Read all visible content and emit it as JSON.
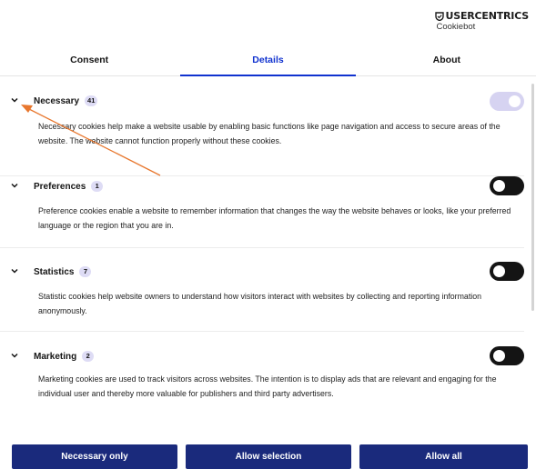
{
  "brand": {
    "name": "USERCENTRICS",
    "sub": "Cookiebot"
  },
  "tabs": [
    {
      "label": "Consent",
      "active": false
    },
    {
      "label": "Details",
      "active": true
    },
    {
      "label": "About",
      "active": false
    }
  ],
  "sections": [
    {
      "title": "Necessary",
      "count": "41",
      "toggle_on": true,
      "toggle_disabled": true,
      "description": "Necessary cookies help make a website usable by enabling basic functions like page navigation and access to secure areas of the website. The website cannot function properly without these cookies."
    },
    {
      "title": "Preferences",
      "count": "1",
      "toggle_on": false,
      "toggle_disabled": false,
      "description": "Preference cookies enable a website to remember information that changes the way the website behaves or looks, like your preferred language or the region that you are in."
    },
    {
      "title": "Statistics",
      "count": "7",
      "toggle_on": false,
      "toggle_disabled": false,
      "description": "Statistic cookies help website owners to understand how visitors interact with websites by collecting and reporting information anonymously."
    },
    {
      "title": "Marketing",
      "count": "2",
      "toggle_on": false,
      "toggle_disabled": false,
      "description": "Marketing cookies are used to track visitors across websites. The intention is to display ads that are relevant and engaging for the individual user and thereby more valuable for publishers and third party advertisers."
    }
  ],
  "buttons": {
    "necessary_only": "Necessary only",
    "allow_selection": "Allow selection",
    "allow_all": "Allow all"
  },
  "colors": {
    "accent": "#1032cf",
    "button_bg": "#1a2a7c",
    "toggle_off": "#141414",
    "toggle_disabled": "#d6d3f1",
    "badge_bg": "#dedcf5",
    "annotation_arrow": "#e8772e"
  },
  "annotation": {
    "icon": "orange-arrow-pointing-at-necessary-chevron"
  }
}
